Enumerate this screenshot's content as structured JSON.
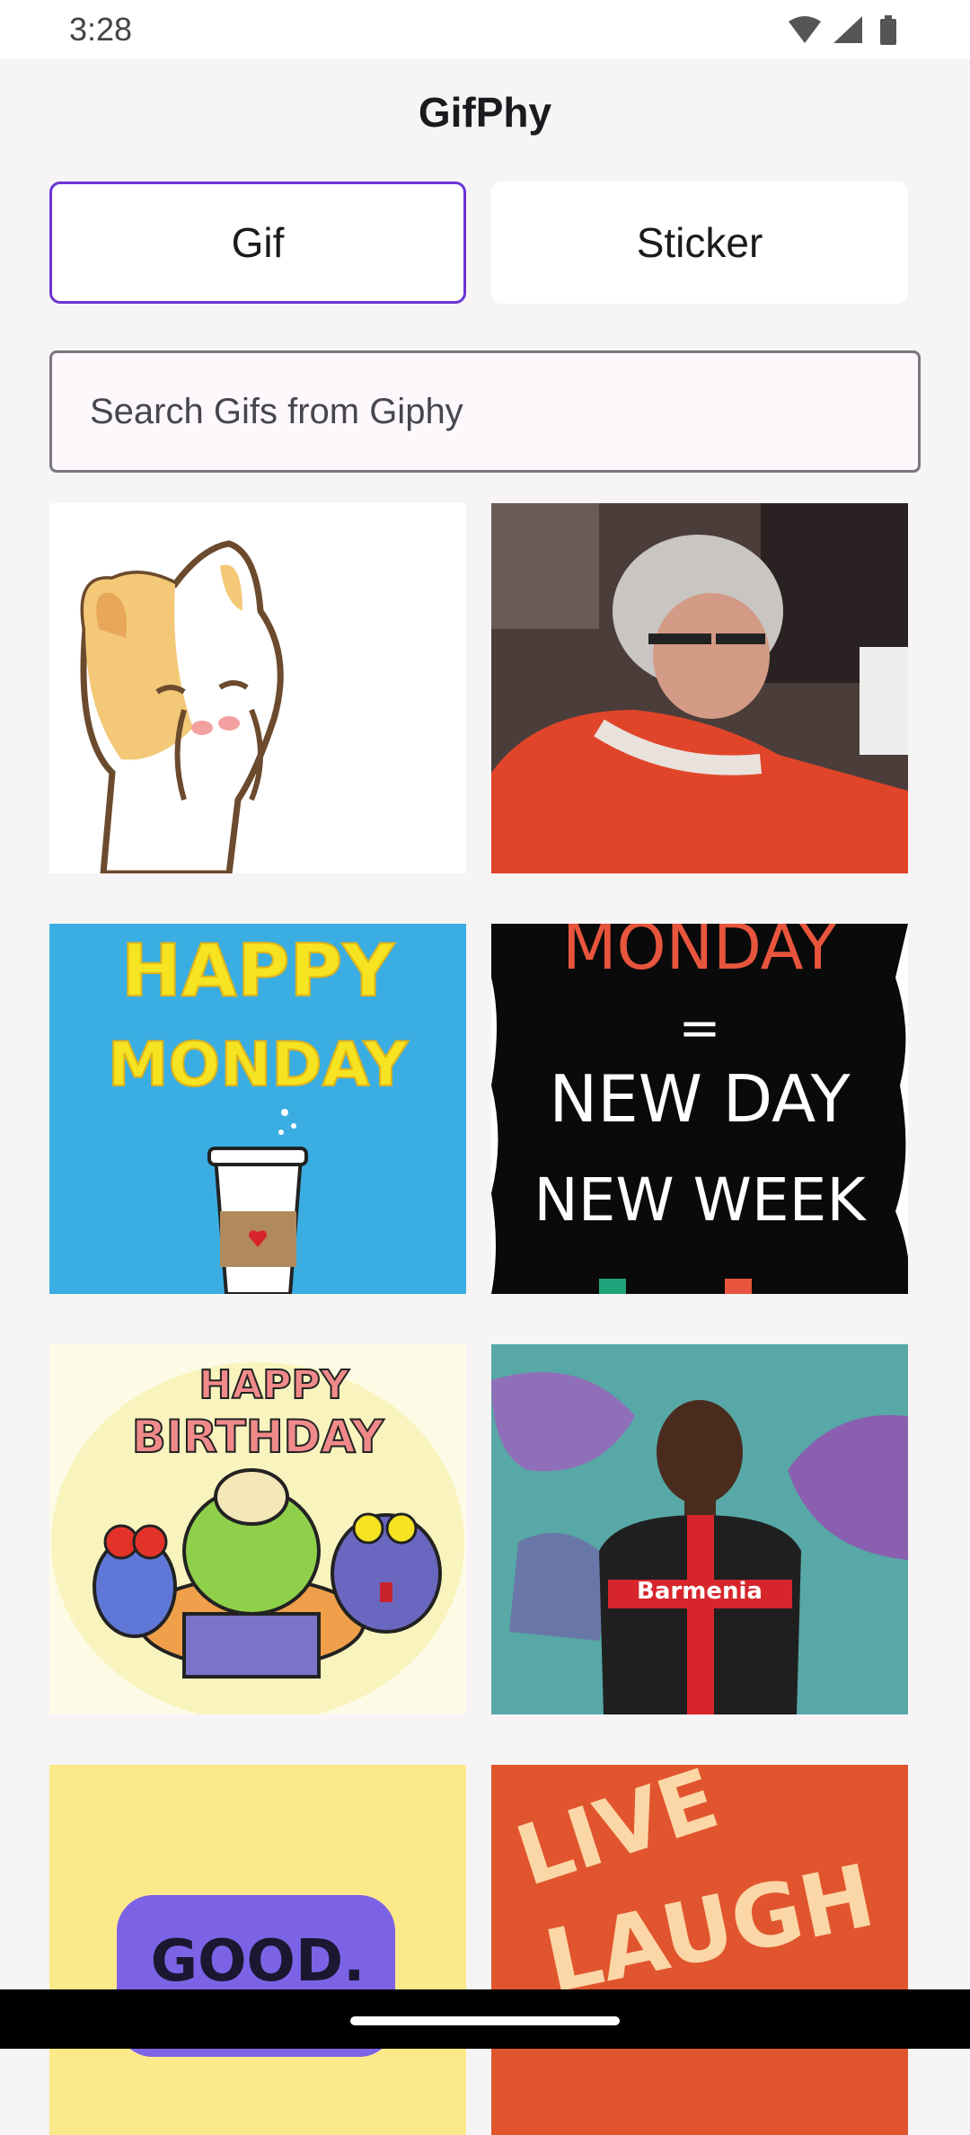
{
  "status_bar": {
    "time": "3:28",
    "icons": [
      "wifi-icon",
      "signal-icon",
      "battery-icon"
    ]
  },
  "header": {
    "title": "GifPhy"
  },
  "tabs": [
    {
      "label": "Gif",
      "selected": true
    },
    {
      "label": "Sticker",
      "selected": false
    }
  ],
  "search": {
    "placeholder": "Search Gifs from Giphy"
  },
  "gifs": [
    {
      "subject": "cartoon cat covering face"
    },
    {
      "subject": "grandma in red sweater"
    },
    {
      "subject": "happy monday coffee cup",
      "text_lines": [
        "HAPPY",
        "MONDAY"
      ]
    },
    {
      "subject": "monday new day new week",
      "text_lines": [
        "MONDAY",
        "=",
        "NEW DAY",
        "NEW WEEK"
      ]
    },
    {
      "subject": "happy birthday cartoon party",
      "text_lines": [
        "HAPPY",
        "BIRTHDAY"
      ]
    },
    {
      "subject": "football player in red black jersey",
      "text_lines": [
        "Barmenia"
      ]
    },
    {
      "subject": "good morning purple bubble",
      "text_lines": [
        "GOOD."
      ]
    },
    {
      "subject": "live laugh lettering",
      "text_lines": [
        "LIVE",
        "LAUGH"
      ]
    }
  ],
  "colors": {
    "accent": "#6a35d6",
    "background": "#f6f4f4",
    "tile_blue": "#3aaee2",
    "tile_orange": "#e0552e"
  }
}
